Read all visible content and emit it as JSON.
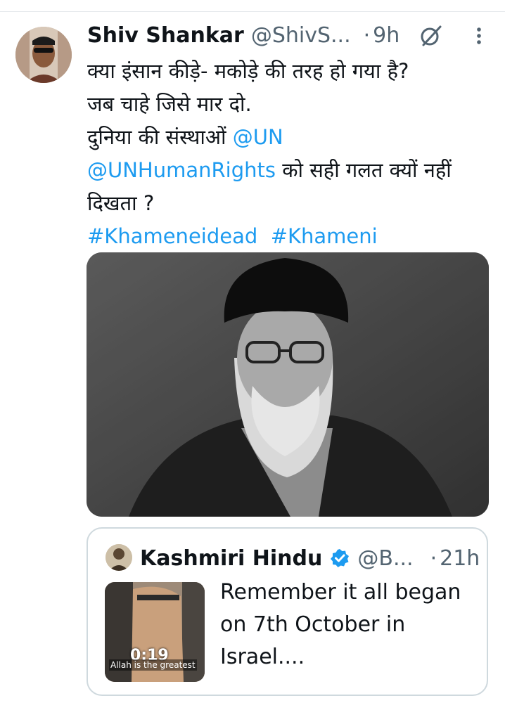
{
  "tweet": {
    "author_name": "Shiv Shankar",
    "author_handle": "@ShivS...",
    "separator": "·",
    "time": "9h",
    "grok_icon": "grok-icon",
    "more_icon": "more-icon",
    "text_lines": {
      "line1": "क्या इंसान कीड़े- मकोड़े की तरह हो गया है?",
      "line2": "जब चाहे जिसे मार दो.",
      "line3_text": "दुनिया की संस्थाओं ",
      "line3_mention": "@UN",
      "line4_mention": "@UNHumanRights",
      "line4_text": " को सही गलत क्यों नहीं",
      "line5": "दिखता ?",
      "hashtag1": "#Khameneidead",
      "hashtag2": "#Khameni"
    }
  },
  "quote": {
    "author_name": "Kashmiri Hindu",
    "verified_icon": "verified-badge-icon",
    "author_handle": "@B...",
    "separator": "·",
    "time": "21h",
    "text": "Remember it all began on 7th October in Israel....",
    "video_duration": "0:19",
    "video_caption": "Allah is the greatest"
  },
  "colors": {
    "link": "#1d9bf0",
    "secondary": "#536471",
    "border": "#cfd9de",
    "verified": "#1d9bf0"
  }
}
